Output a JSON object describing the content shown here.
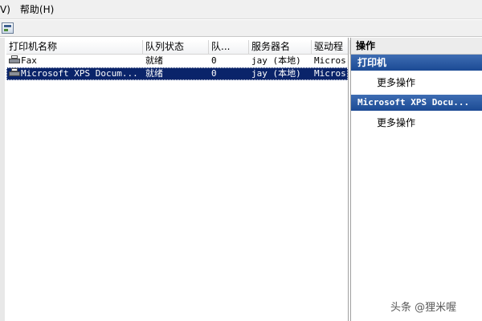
{
  "menubar": {
    "items": [
      "V)",
      "帮助(H)"
    ]
  },
  "list": {
    "columns": [
      "打印机名称",
      "队列状态",
      "队...",
      "服务器名",
      "驱动程"
    ],
    "rows": [
      {
        "name": "Fax",
        "status": "就绪",
        "queue": "0",
        "server": "jay (本地)",
        "driver": "Micros",
        "selected": false
      },
      {
        "name": "Microsoft XPS Docum...",
        "status": "就绪",
        "queue": "0",
        "server": "jay (本地)",
        "driver": "Micros",
        "selected": true
      }
    ]
  },
  "actions": {
    "title": "操作",
    "sections": [
      {
        "heading": "打印机",
        "items": [
          "更多操作"
        ]
      },
      {
        "heading": "Microsoft XPS Docu...",
        "items": [
          "更多操作"
        ]
      }
    ]
  },
  "watermark": "头条 @狸米喔",
  "colors": {
    "selection": "#0a246a",
    "section_header": "#2a5aa0"
  }
}
